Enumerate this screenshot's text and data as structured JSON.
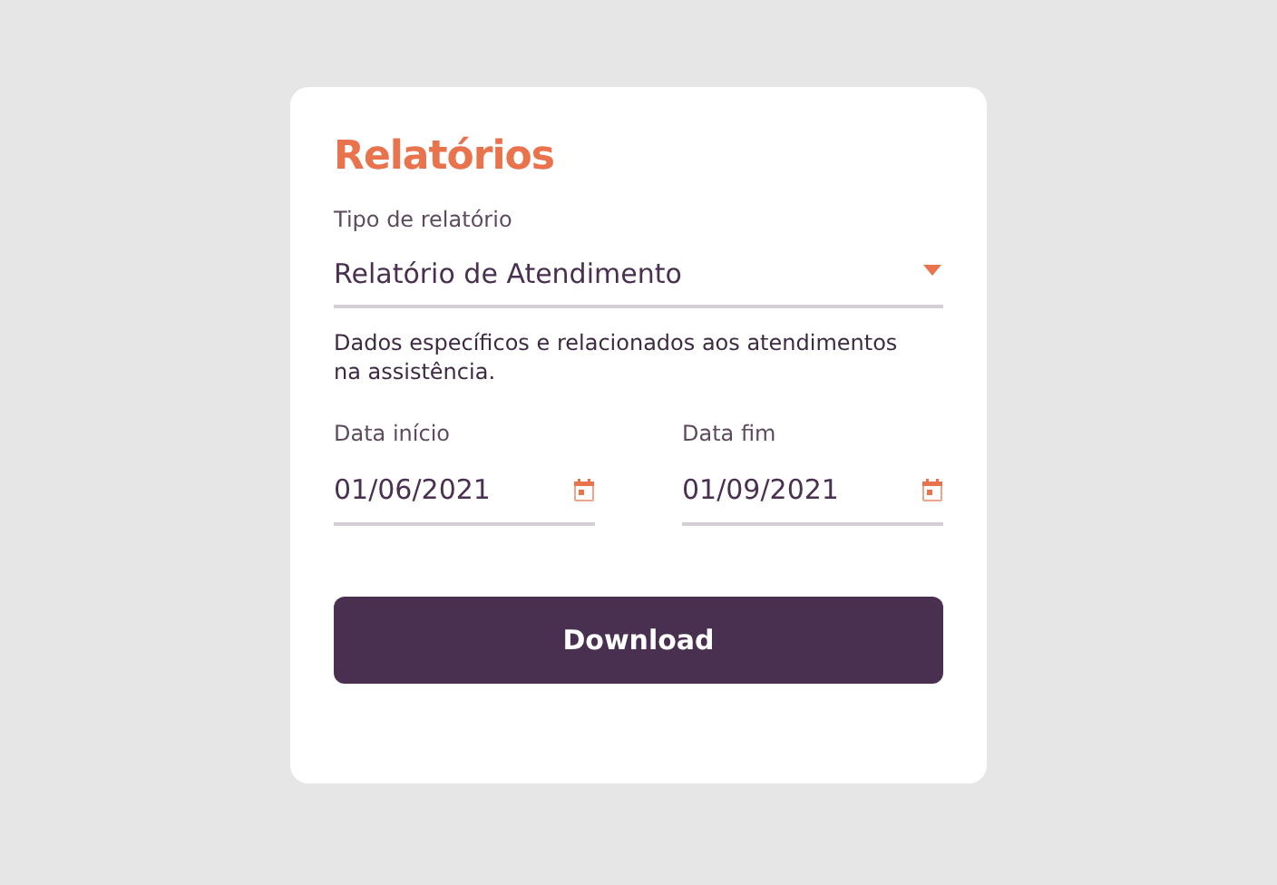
{
  "card": {
    "title": "Relatórios",
    "report_type": {
      "label": "Tipo de relatório",
      "value": "Relatório de Atendimento"
    },
    "description": "Dados específicos e relacionados aos atendimentos na assistência.",
    "dates": [
      {
        "label": "Data início",
        "value": "01/06/2021"
      },
      {
        "label": "Data fim",
        "value": "01/09/2021"
      }
    ],
    "button": "Download"
  }
}
